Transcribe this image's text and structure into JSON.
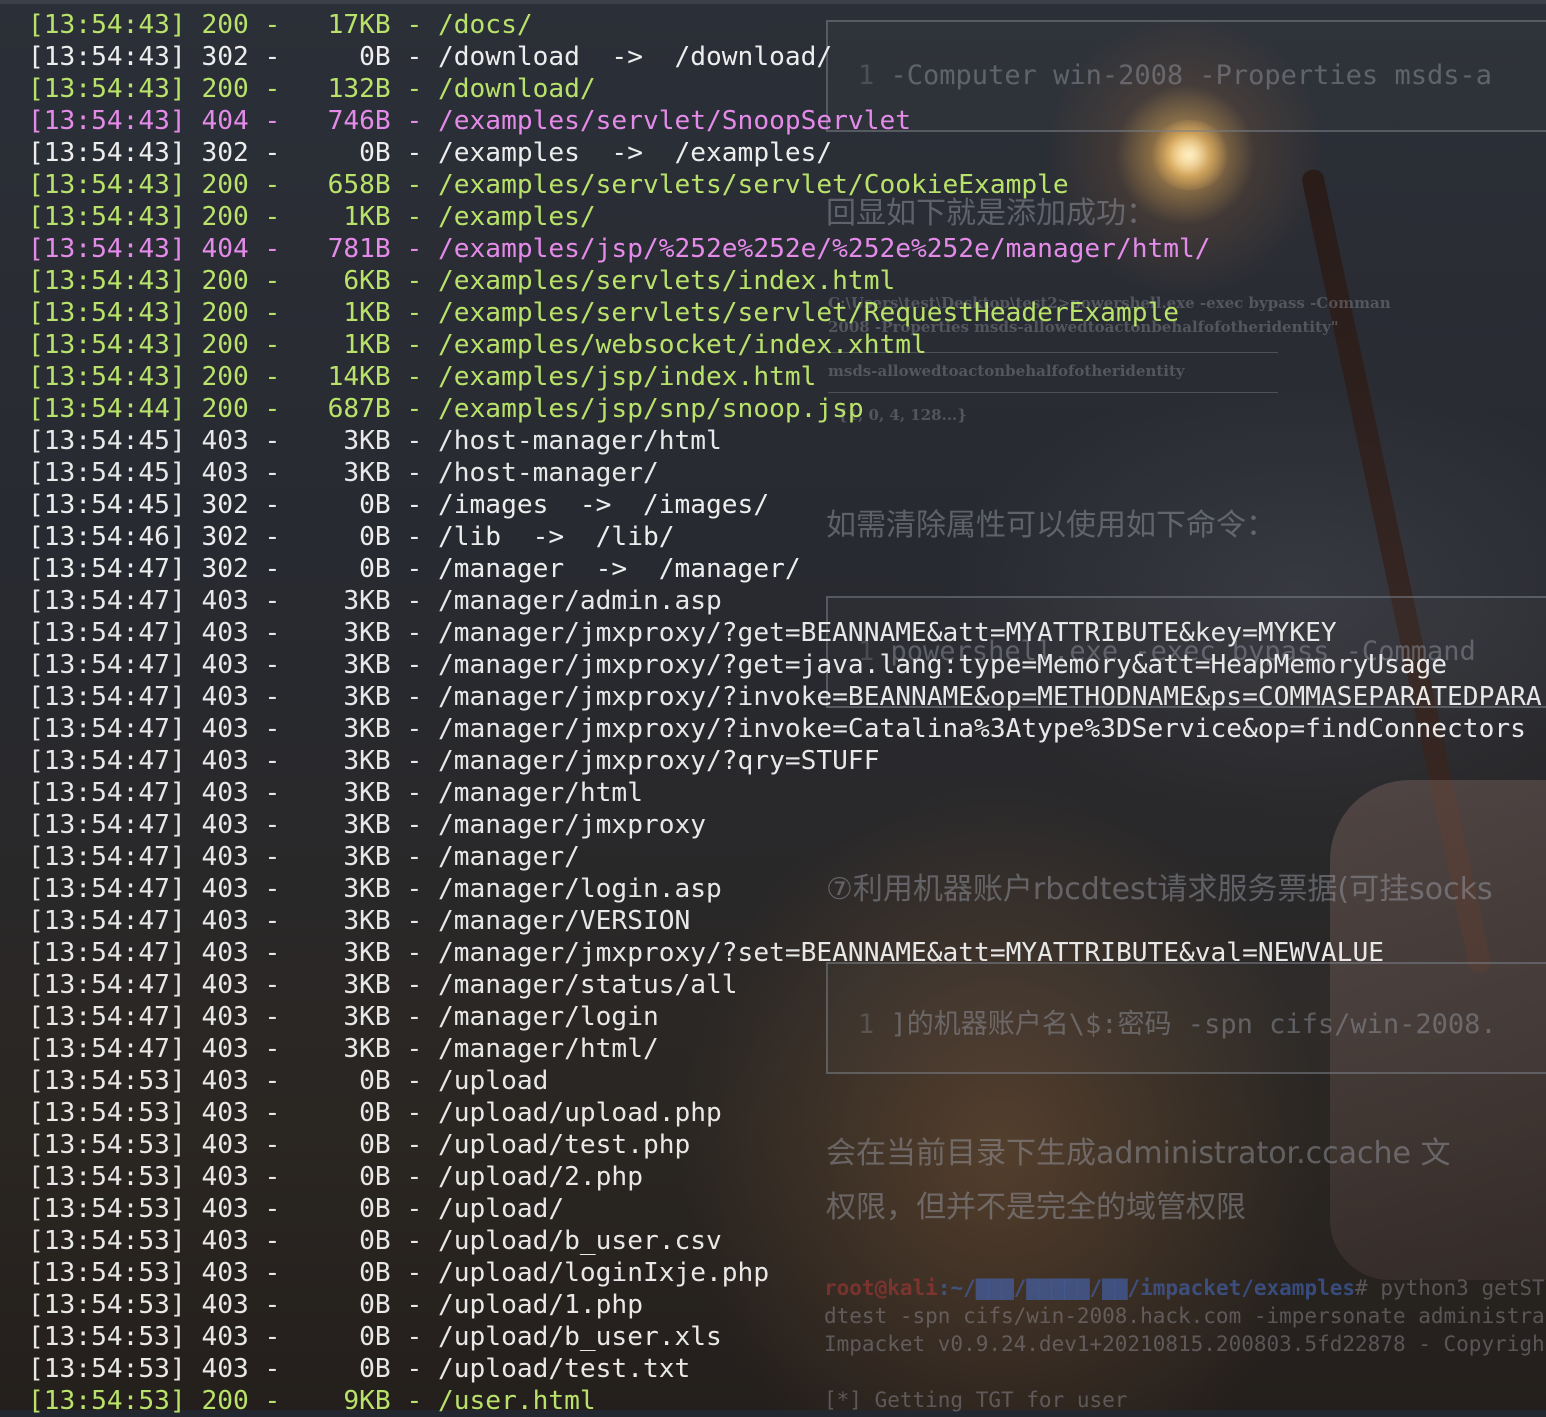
{
  "theme": {
    "status_colors": {
      "200": "#b9e26a",
      "302": "#ededed",
      "403": "#e8e8e8",
      "404": "#e48be9"
    },
    "background": "#232730"
  },
  "log": [
    {
      "time": "[13:54:43]",
      "status": "200",
      "size": "17KB",
      "path": "/docs/"
    },
    {
      "time": "[13:54:43]",
      "status": "302",
      "size": "0B",
      "path": "/download  ->  /download/"
    },
    {
      "time": "[13:54:43]",
      "status": "200",
      "size": "132B",
      "path": "/download/"
    },
    {
      "time": "[13:54:43]",
      "status": "404",
      "size": "746B",
      "path": "/examples/servlet/SnoopServlet"
    },
    {
      "time": "[13:54:43]",
      "status": "302",
      "size": "0B",
      "path": "/examples  ->  /examples/"
    },
    {
      "time": "[13:54:43]",
      "status": "200",
      "size": "658B",
      "path": "/examples/servlets/servlet/CookieExample"
    },
    {
      "time": "[13:54:43]",
      "status": "200",
      "size": "1KB",
      "path": "/examples/"
    },
    {
      "time": "[13:54:43]",
      "status": "404",
      "size": "781B",
      "path": "/examples/jsp/%252e%252e/%252e%252e/manager/html/"
    },
    {
      "time": "[13:54:43]",
      "status": "200",
      "size": "6KB",
      "path": "/examples/servlets/index.html"
    },
    {
      "time": "[13:54:43]",
      "status": "200",
      "size": "1KB",
      "path": "/examples/servlets/servlet/RequestHeaderExample"
    },
    {
      "time": "[13:54:43]",
      "status": "200",
      "size": "1KB",
      "path": "/examples/websocket/index.xhtml"
    },
    {
      "time": "[13:54:43]",
      "status": "200",
      "size": "14KB",
      "path": "/examples/jsp/index.html"
    },
    {
      "time": "[13:54:44]",
      "status": "200",
      "size": "687B",
      "path": "/examples/jsp/snp/snoop.jsp"
    },
    {
      "time": "[13:54:45]",
      "status": "403",
      "size": "3KB",
      "path": "/host-manager/html"
    },
    {
      "time": "[13:54:45]",
      "status": "403",
      "size": "3KB",
      "path": "/host-manager/"
    },
    {
      "time": "[13:54:45]",
      "status": "302",
      "size": "0B",
      "path": "/images  ->  /images/"
    },
    {
      "time": "[13:54:46]",
      "status": "302",
      "size": "0B",
      "path": "/lib  ->  /lib/"
    },
    {
      "time": "[13:54:47]",
      "status": "302",
      "size": "0B",
      "path": "/manager  ->  /manager/"
    },
    {
      "time": "[13:54:47]",
      "status": "403",
      "size": "3KB",
      "path": "/manager/admin.asp"
    },
    {
      "time": "[13:54:47]",
      "status": "403",
      "size": "3KB",
      "path": "/manager/jmxproxy/?get=BEANNAME&att=MYATTRIBUTE&key=MYKEY"
    },
    {
      "time": "[13:54:47]",
      "status": "403",
      "size": "3KB",
      "path": "/manager/jmxproxy/?get=java.lang:type=Memory&att=HeapMemoryUsage"
    },
    {
      "time": "[13:54:47]",
      "status": "403",
      "size": "3KB",
      "path": "/manager/jmxproxy/?invoke=BEANNAME&op=METHODNAME&ps=COMMASEPARATEDPARA"
    },
    {
      "time": "[13:54:47]",
      "status": "403",
      "size": "3KB",
      "path": "/manager/jmxproxy/?invoke=Catalina%3Atype%3DService&op=findConnectors"
    },
    {
      "time": "[13:54:47]",
      "status": "403",
      "size": "3KB",
      "path": "/manager/jmxproxy/?qry=STUFF"
    },
    {
      "time": "[13:54:47]",
      "status": "403",
      "size": "3KB",
      "path": "/manager/html"
    },
    {
      "time": "[13:54:47]",
      "status": "403",
      "size": "3KB",
      "path": "/manager/jmxproxy"
    },
    {
      "time": "[13:54:47]",
      "status": "403",
      "size": "3KB",
      "path": "/manager/"
    },
    {
      "time": "[13:54:47]",
      "status": "403",
      "size": "3KB",
      "path": "/manager/login.asp"
    },
    {
      "time": "[13:54:47]",
      "status": "403",
      "size": "3KB",
      "path": "/manager/VERSION"
    },
    {
      "time": "[13:54:47]",
      "status": "403",
      "size": "3KB",
      "path": "/manager/jmxproxy/?set=BEANNAME&att=MYATTRIBUTE&val=NEWVALUE"
    },
    {
      "time": "[13:54:47]",
      "status": "403",
      "size": "3KB",
      "path": "/manager/status/all"
    },
    {
      "time": "[13:54:47]",
      "status": "403",
      "size": "3KB",
      "path": "/manager/login"
    },
    {
      "time": "[13:54:47]",
      "status": "403",
      "size": "3KB",
      "path": "/manager/html/"
    },
    {
      "time": "[13:54:53]",
      "status": "403",
      "size": "0B",
      "path": "/upload"
    },
    {
      "time": "[13:54:53]",
      "status": "403",
      "size": "0B",
      "path": "/upload/upload.php"
    },
    {
      "time": "[13:54:53]",
      "status": "403",
      "size": "0B",
      "path": "/upload/test.php"
    },
    {
      "time": "[13:54:53]",
      "status": "403",
      "size": "0B",
      "path": "/upload/2.php"
    },
    {
      "time": "[13:54:53]",
      "status": "403",
      "size": "0B",
      "path": "/upload/"
    },
    {
      "time": "[13:54:53]",
      "status": "403",
      "size": "0B",
      "path": "/upload/b_user.csv"
    },
    {
      "time": "[13:54:53]",
      "status": "403",
      "size": "0B",
      "path": "/upload/loginIxje.php"
    },
    {
      "time": "[13:54:53]",
      "status": "403",
      "size": "0B",
      "path": "/upload/1.php"
    },
    {
      "time": "[13:54:53]",
      "status": "403",
      "size": "0B",
      "path": "/upload/b_user.xls"
    },
    {
      "time": "[13:54:53]",
      "status": "403",
      "size": "0B",
      "path": "/upload/test.txt"
    },
    {
      "time": "[13:54:53]",
      "status": "200",
      "size": "9KB",
      "path": "/user.html"
    }
  ],
  "overlay": {
    "code1_num": "1",
    "code1_text": "-Computer win-2008 -Properties msds-a",
    "heading1": "回显如下就是添加成功：",
    "shot_line1": "C:\\Users\\test\\Desktop\\test2>powershell.exe -exec bypass -Comman",
    "shot_line2": "2008 -Properties msds-allowedtoactonbehalfofotheridentity\"",
    "shot_line3": "msds-allowedtoactonbehalfofotheridentity",
    "shot_line4": "{1, 0, 4, 128...}",
    "heading2": "如需清除属性可以使用如下命令：",
    "code2_num": "1",
    "code2_text": "powershell.exe -exec bypass -Command",
    "heading3": "⑦利用机器账户rbcdtest请求服务票据(可挂socks",
    "code3_num": "1",
    "code3_text": "]的机器账户名\\$:密码 -spn cifs/win-2008.",
    "para1": "会在当前目录下生成administrator.ccache 文",
    "para2": "权限，但并不是完全的域管权限",
    "term_root": "root@kali",
    "term_path": ":~/▇▇▇/▇▇▇▇▇/▇▇/impacket/examples",
    "term_cmd": "# python3 getST",
    "term_line2": "dtest -spn cifs/win-2008.hack.com -impersonate administra",
    "term_line3": "Impacket v0.9.24.dev1+20210815.200803.5fd22878 - Copyrigh",
    "term_line4": "[*] Getting TGT for user"
  }
}
